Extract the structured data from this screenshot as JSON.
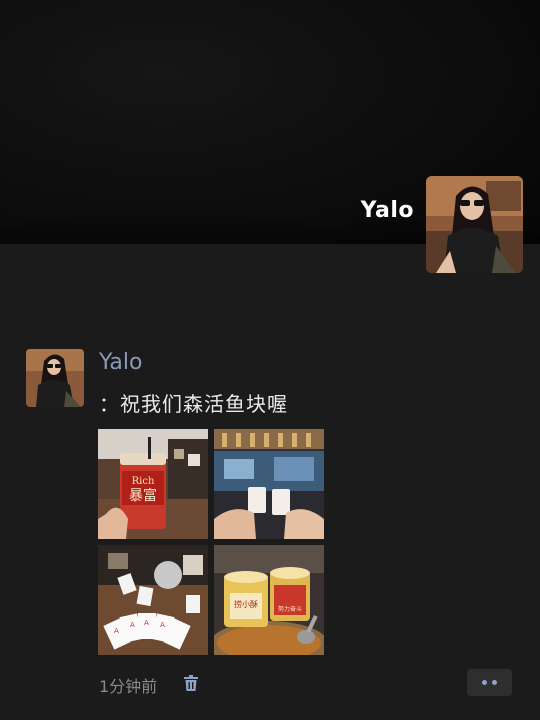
{
  "profile": {
    "name": "Yalo",
    "avatar_icon": "avatar-photo-girl-sunglasses"
  },
  "post": {
    "author": "Yalo",
    "text": "：祝我们森活鱼块喔",
    "time": "1分钟前",
    "photos": [
      {
        "icon": "photo-drink-cup",
        "cup_text_top": "Rich",
        "cup_text_main": "暴富"
      },
      {
        "icon": "photo-cheers-cups"
      },
      {
        "icon": "photo-playing-cards"
      },
      {
        "icon": "photo-hotpot-drinks",
        "cup_text_main": "捞小酥",
        "cup_text_side": "努力奋斗"
      }
    ],
    "trash_icon": "trash-icon",
    "more_icon": "more-dots-icon"
  }
}
